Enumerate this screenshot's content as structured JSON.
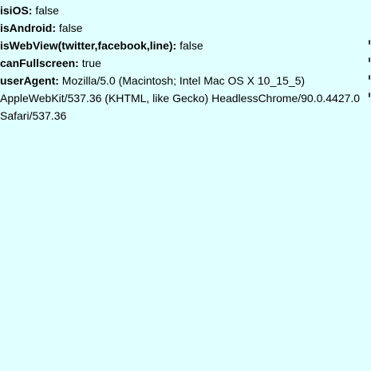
{
  "rows": [
    {
      "key": "isiOS:",
      "value": "false"
    },
    {
      "key": "isAndroid:",
      "value": "false"
    },
    {
      "key": "isWebView(twitter,facebook,line):",
      "value": "false"
    },
    {
      "key": "canFullscreen:",
      "value": "true"
    },
    {
      "key": "userAgent:",
      "value": "Mozilla/5.0 (Macintosh; Intel Mac OS X 10_15_5) AppleWebKit/537.36 (KHTML, like Gecko) HeadlessChrome/90.0.4427.0 Safari/537.36"
    }
  ]
}
